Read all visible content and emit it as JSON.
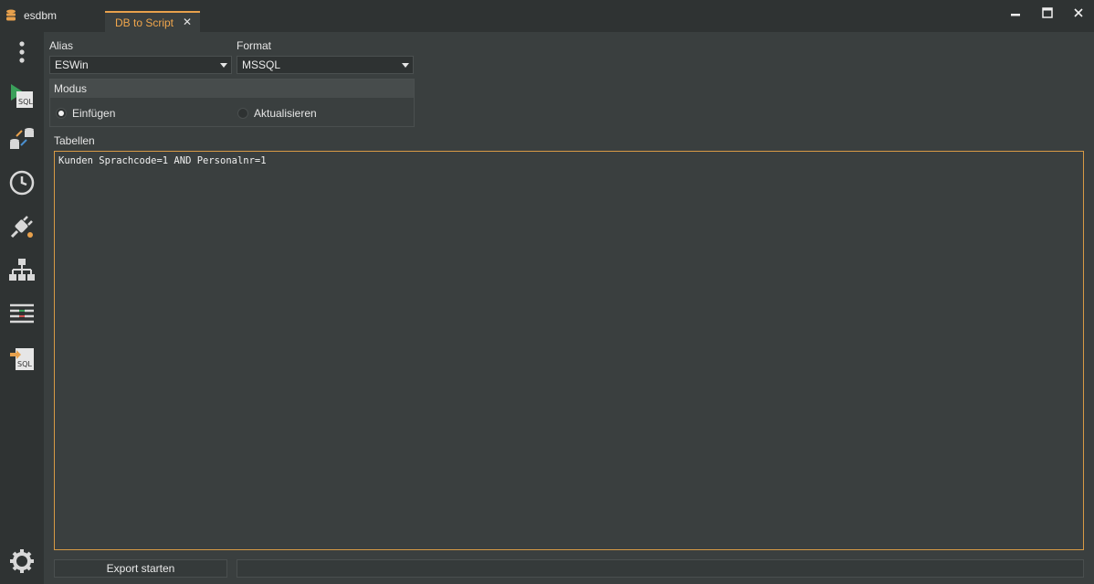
{
  "app": {
    "title": "esdbm"
  },
  "tab": {
    "label": "DB to Script",
    "close": "✕"
  },
  "window": {
    "minimize": "—",
    "maximize": "☐",
    "close": "✕"
  },
  "sidebar": {
    "items": [
      {
        "name": "menu-dots-icon"
      },
      {
        "name": "sql-run-icon",
        "text": "SQL"
      },
      {
        "name": "db-compare-icon"
      },
      {
        "name": "history-clock-icon"
      },
      {
        "name": "plug-settings-icon"
      },
      {
        "name": "hierarchy-icon"
      },
      {
        "name": "list-compare-icon"
      },
      {
        "name": "sql-export-icon",
        "text": "SQL"
      }
    ],
    "settings": "gear-icon"
  },
  "form": {
    "alias_label": "Alias",
    "alias_value": "ESWin",
    "format_label": "Format",
    "format_value": "MSSQL",
    "modus_label": "Modus",
    "radio_insert": "Einfügen",
    "radio_update": "Aktualisieren",
    "selected_mode": "Einfügen",
    "tables_label": "Tabellen",
    "tables_text": "Kunden Sprachcode=1 AND Personalnr=1",
    "export_button": "Export starten"
  },
  "colors": {
    "accent": "#e8a14c",
    "background": "#3a3f3f",
    "sidebar": "#2f3333"
  }
}
